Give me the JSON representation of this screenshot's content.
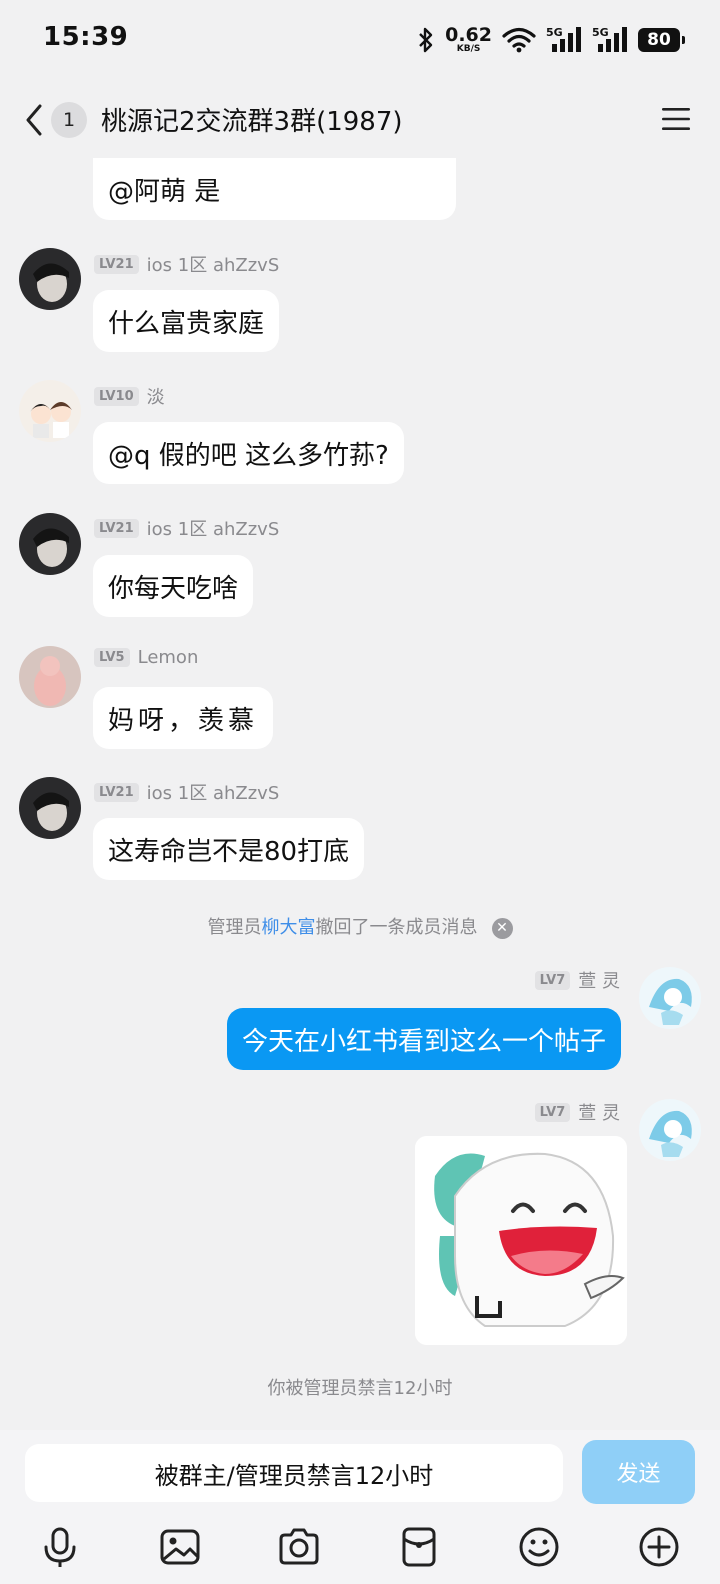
{
  "status_bar": {
    "time": "15:39",
    "net_speed": "0.62",
    "net_unit": "KB/S",
    "signal_1": "5G",
    "signal_2": "5G",
    "battery": "80"
  },
  "header": {
    "badge": "1",
    "title": "桃源记2交流群3群(1987)"
  },
  "messages": [
    {
      "text": "@阿萌 是"
    },
    {
      "level": "LV21",
      "name": "ios 1区 ahZzvS",
      "text": "什么富贵家庭"
    },
    {
      "level": "LV10",
      "name": "淡",
      "text": "@q 假的吧 这么多竹荪?"
    },
    {
      "level": "LV21",
      "name": "ios 1区 ahZzvS",
      "text": "你每天吃啥"
    },
    {
      "level": "LV5",
      "name": "Lemon",
      "text": "妈呀，羡慕"
    },
    {
      "level": "LV21",
      "name": "ios 1区 ahZzvS",
      "text": "这寿命岂不是80打底"
    }
  ],
  "system_recall": {
    "prefix": "管理员",
    "admin_name": "柳大富",
    "suffix": "撤回了一条成员消息"
  },
  "my_messages": [
    {
      "level": "LV7",
      "name": "萱 灵",
      "text": "今天在小红书看到这么一个帖子"
    },
    {
      "level": "LV7",
      "name": "萱 灵",
      "sticker": "laughing-cartoon-sticker"
    }
  ],
  "system_muted": "你被管理员禁言12小时",
  "input": {
    "placeholder": "被群主/管理员禁言12小时",
    "send_label": "发送"
  },
  "toolbar_icons": [
    "microphone-icon",
    "image-icon",
    "camera-icon",
    "red-packet-icon",
    "emoji-icon",
    "plus-icon"
  ],
  "colors": {
    "my_bubble": "#0a98f3",
    "send_button_disabled": "#8fcff7",
    "admin_link": "#3f8ee8"
  }
}
